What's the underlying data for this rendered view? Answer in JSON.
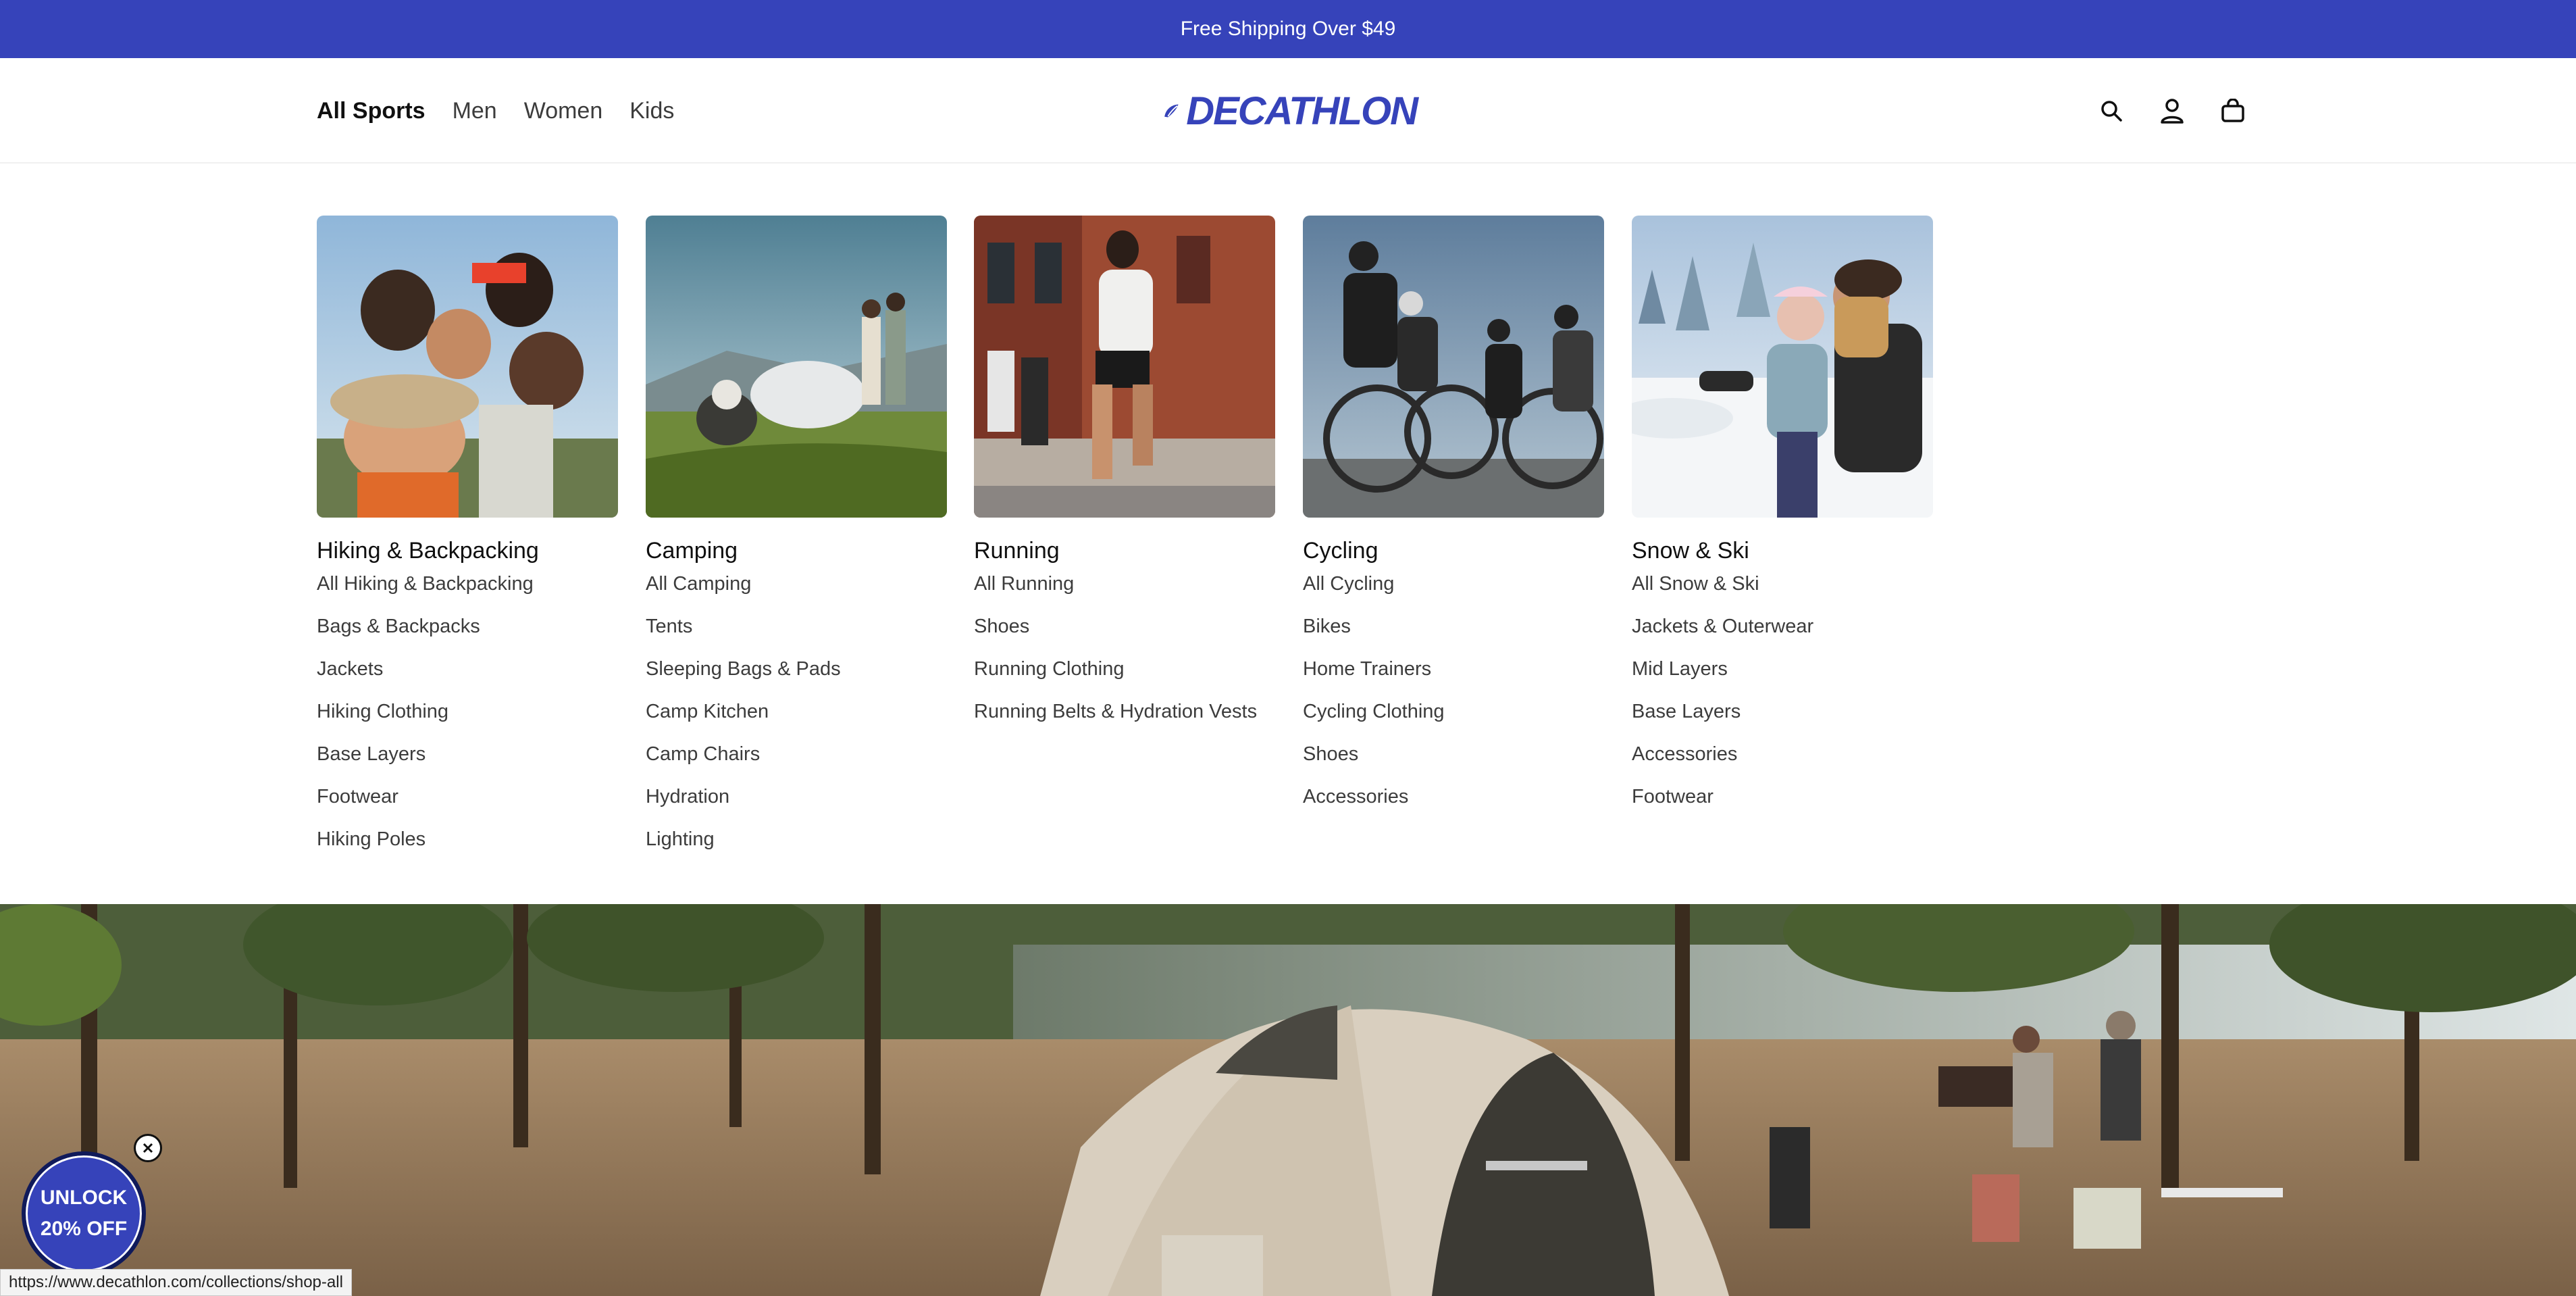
{
  "promo_bar": {
    "text": "Free Shipping Over $49"
  },
  "header": {
    "nav": [
      {
        "label": "All Sports",
        "active": true
      },
      {
        "label": "Men"
      },
      {
        "label": "Women"
      },
      {
        "label": "Kids"
      }
    ],
    "logo_text": "DECATHLON",
    "icons": [
      "search-icon",
      "account-icon",
      "cart-icon"
    ]
  },
  "mega_menu": {
    "columns": [
      {
        "title": "Hiking & Backpacking",
        "links": [
          "All Hiking & Backpacking",
          "Bags & Backpacks",
          "Jackets",
          "Hiking Clothing",
          "Base Layers",
          "Footwear",
          "Hiking Poles"
        ]
      },
      {
        "title": "Camping",
        "links": [
          "All Camping",
          "Tents",
          "Sleeping Bags & Pads",
          "Camp Kitchen",
          "Camp Chairs",
          "Hydration",
          "Lighting"
        ]
      },
      {
        "title": "Running",
        "links": [
          "All Running",
          "Shoes",
          "Running Clothing",
          "Running Belts & Hydration Vests"
        ]
      },
      {
        "title": "Cycling",
        "links": [
          "All Cycling",
          "Bikes",
          "Home Trainers",
          "Cycling Clothing",
          "Shoes",
          "Accessories"
        ]
      },
      {
        "title": "Snow & Ski",
        "links": [
          "All Snow & Ski",
          "Jackets & Outerwear",
          "Mid Layers",
          "Base Layers",
          "Accessories",
          "Footwear"
        ]
      }
    ]
  },
  "promo_badge": {
    "line1": "UNLOCK",
    "line2": "20% OFF"
  },
  "status_url": "https://www.decathlon.com/collections/shop-all",
  "colors": {
    "brand": "#3643ba",
    "text": "#101010",
    "muted": "#3c3c3c"
  }
}
